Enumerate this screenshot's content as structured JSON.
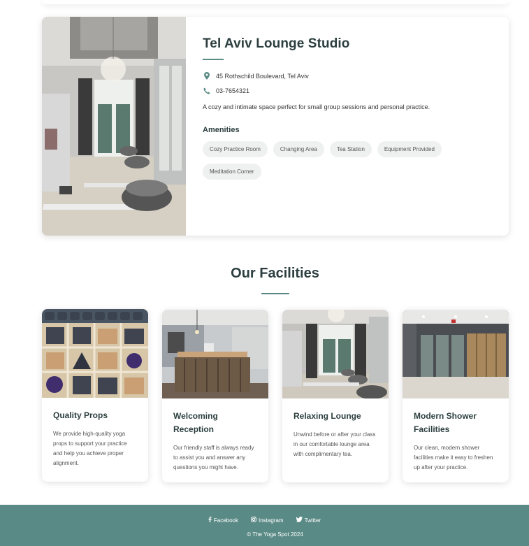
{
  "studio": {
    "name": "Tel Aviv Lounge Studio",
    "address": "45 Rothschild Boulevard, Tel Aviv",
    "phone": "03-7654321",
    "description": "A cozy and intimate space perfect for small group sessions and personal practice.",
    "amenities_title": "Amenities",
    "amenities": [
      "Cozy Practice Room",
      "Changing Area",
      "Tea Station",
      "Equipment Provided",
      "Meditation Corner"
    ],
    "icons": {
      "address": "map-marker-icon",
      "phone": "phone-icon"
    }
  },
  "facilities": {
    "title": "Our Facilities",
    "cards": [
      {
        "title": "Quality Props",
        "text": "We provide high-quality yoga props to support your practice and help you achieve proper alignment.",
        "image": "yoga-props-shelf"
      },
      {
        "title": "Welcoming Reception",
        "text": "Our friendly staff is always ready to assist you and answer any questions you might have.",
        "image": "reception-desk"
      },
      {
        "title": "Relaxing Lounge",
        "text": "Unwind before or after your class in our comfortable lounge area with complimentary tea.",
        "image": "lounge-room"
      },
      {
        "title": "Modern Shower Facilities",
        "text": "Our clean, modern shower facilities make it easy to freshen up after your practice.",
        "image": "shower-lockers"
      }
    ]
  },
  "footer": {
    "social": [
      {
        "label": "Facebook",
        "icon": "facebook-icon"
      },
      {
        "label": "Instagram",
        "icon": "instagram-icon"
      },
      {
        "label": "Twitter",
        "icon": "twitter-icon"
      }
    ],
    "copyright": "© The Yoga Spot 2024"
  },
  "colors": {
    "accent": "#5a8a85",
    "heading": "#2c3e3f",
    "chip_bg": "#eef1f0"
  }
}
